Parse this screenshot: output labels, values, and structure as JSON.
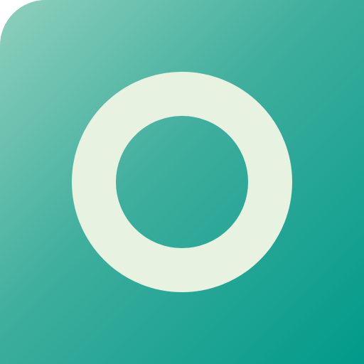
{
  "icon": {
    "name": "ring-icon",
    "shape": "ring",
    "colors": {
      "gradient_light": "#8fd0bd",
      "gradient_mid": "#3fae9d",
      "gradient_dark": "#019a8a",
      "ring": "#e8f2e0"
    }
  }
}
